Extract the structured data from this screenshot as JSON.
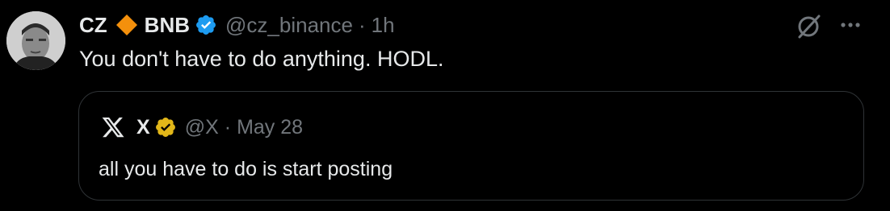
{
  "tweet": {
    "author_name": "CZ",
    "author_name_suffix": "BNB",
    "handle": "@cz_binance",
    "separator": "·",
    "time": "1h",
    "text": "You don't have to do anything. HODL.",
    "icons": {
      "avatar": "avatar",
      "name_emoji": "orange-diamond-icon",
      "verified": "blue-verified-icon",
      "grok": "grok-icon",
      "more": "more-options-icon"
    }
  },
  "quote": {
    "author_name": "X",
    "handle": "@X",
    "separator": "·",
    "time": "May 28",
    "text": "all you have to do is start posting",
    "icons": {
      "avatar": "x-logo-icon",
      "verified": "gold-verified-icon"
    }
  },
  "colors": {
    "background": "#000000",
    "text_primary": "#e7e9ea",
    "text_secondary": "#71767b",
    "border": "#2f3336",
    "verified_blue": "#1d9bf0",
    "verified_gold": "#e2b719",
    "diamond_orange": "#f4900c"
  }
}
